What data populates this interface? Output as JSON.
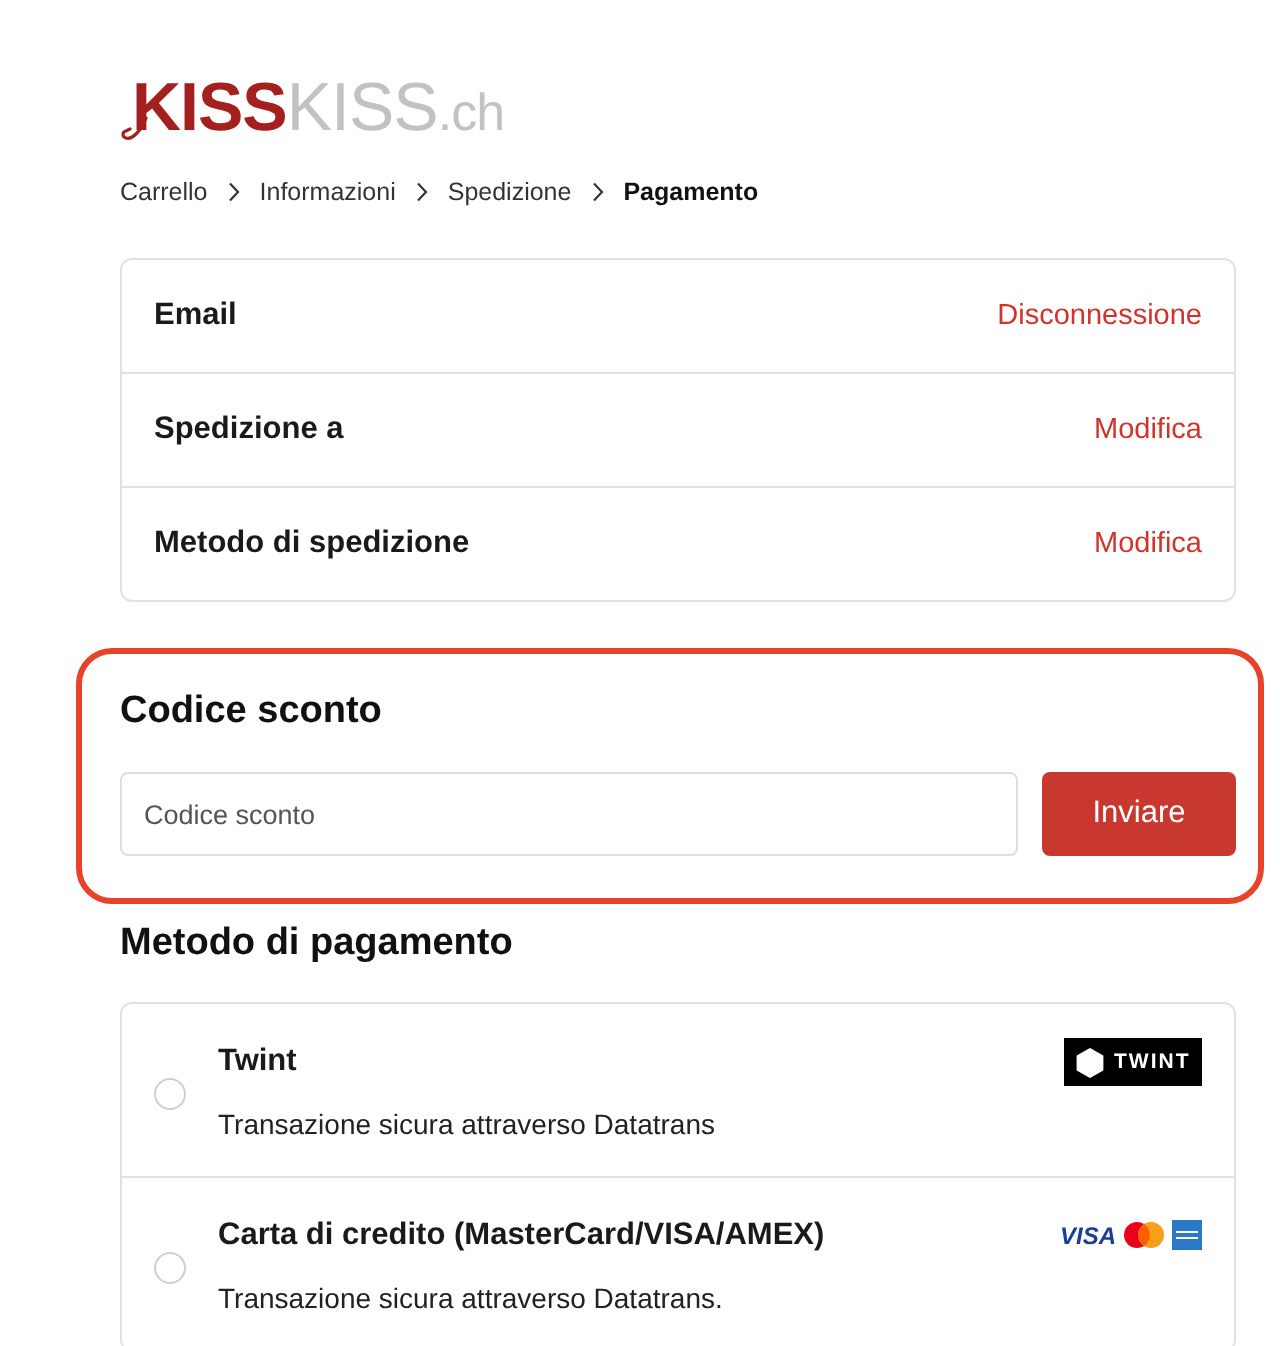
{
  "logo": {
    "strong": "KISS",
    "light": "KISS",
    "suffix": ".ch"
  },
  "breadcrumb": [
    {
      "label": "Carrello",
      "current": false
    },
    {
      "label": "Informazioni",
      "current": false
    },
    {
      "label": "Spedizione",
      "current": false
    },
    {
      "label": "Pagamento",
      "current": true
    }
  ],
  "summary": [
    {
      "label": "Email",
      "action": "Disconnessione"
    },
    {
      "label": "Spedizione a",
      "action": "Modifica"
    },
    {
      "label": "Metodo di spedizione",
      "action": "Modifica"
    }
  ],
  "discount": {
    "title": "Codice sconto",
    "placeholder": "Codice sconto",
    "button": "Inviare",
    "highlighted": true
  },
  "payment": {
    "title": "Metodo di pagamento",
    "methods": [
      {
        "name": "Twint",
        "description": "Transazione sicura attraverso Datatrans",
        "selected": false,
        "logo": {
          "kind": "twint",
          "text": "TWINT"
        }
      },
      {
        "name": "Carta di credito (MasterCard/VISA/AMEX)",
        "description": "Transazione sicura attraverso Datatrans.",
        "selected": false,
        "logo": {
          "kind": "cards",
          "text": "VISA"
        }
      }
    ]
  }
}
